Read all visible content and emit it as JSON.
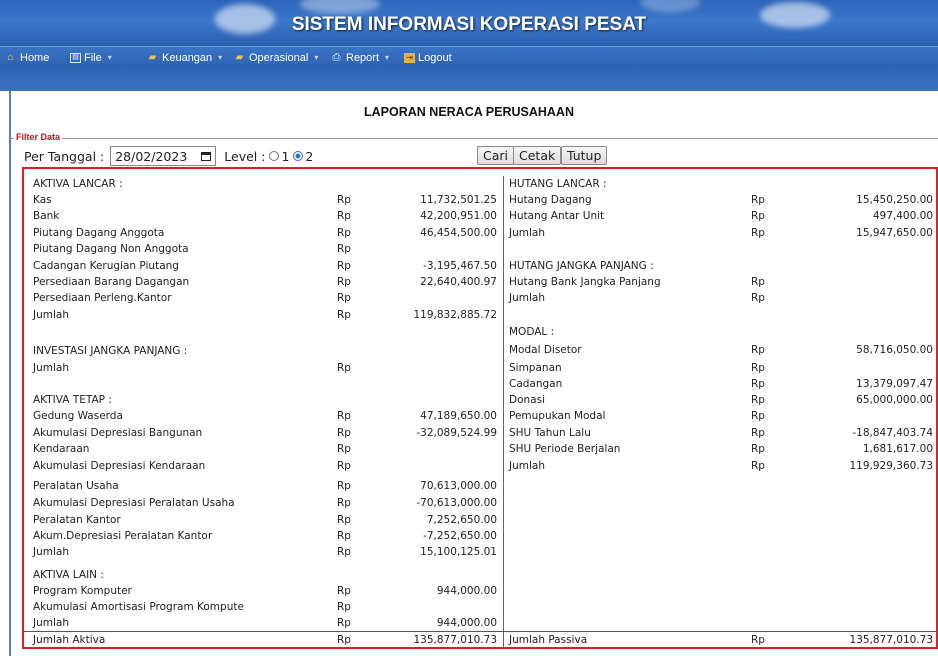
{
  "app": {
    "title": "SISTEM INFORMASI KOPERASI PESAT"
  },
  "menu": [
    {
      "label": "Home",
      "icon": "home-icon"
    },
    {
      "label": "File",
      "icon": "file-icon",
      "dropdown": true
    },
    {
      "label": "Keuangan",
      "icon": "folder-icon",
      "dropdown": true
    },
    {
      "label": "Operasional",
      "icon": "folder-icon",
      "dropdown": true
    },
    {
      "label": "Report",
      "icon": "printer-icon",
      "dropdown": true
    },
    {
      "label": "Logout",
      "icon": "logout-icon"
    }
  ],
  "page": {
    "title": "LAPORAN NERACA PERUSAHAAN"
  },
  "filter": {
    "legend": "Filter Data",
    "date_label": "Per Tanggal :",
    "date_value": "28/02/2023",
    "level_label": "Level :",
    "level_options": [
      "1",
      "2"
    ],
    "level_selected": "2",
    "buttons": {
      "cari": "Cari",
      "cetak": "Cetak",
      "tutup": "Tutup"
    }
  },
  "report": {
    "currency": "Rp",
    "left": [
      {
        "label": "AKTIVA LANCAR :",
        "type": "header"
      },
      {
        "label": "Kas",
        "value": "11,732,501.25"
      },
      {
        "label": "Bank",
        "value": "42,200,951.00"
      },
      {
        "label": "Piutang Dagang Anggota",
        "value": "46,454,500.00"
      },
      {
        "label": "Piutang Dagang Non Anggota",
        "value": ""
      },
      {
        "label": "Cadangan Kerugian Piutang",
        "value": "-3,195,467.50"
      },
      {
        "label": "Persediaan Barang Dagangan",
        "value": "22,640,400.97"
      },
      {
        "label": "Persediaan Perleng.Kantor",
        "value": ""
      },
      {
        "label": "Jumlah",
        "value": "119,832,885.72"
      },
      {
        "label": "INVESTASI JANGKA PANJANG :",
        "type": "header"
      },
      {
        "label": "Jumlah",
        "value": ""
      },
      {
        "label": "AKTIVA TETAP :",
        "type": "header"
      },
      {
        "label": "Gedung Waserda",
        "value": "47,189,650.00"
      },
      {
        "label": "Akumulasi Depresiasi Bangunan",
        "value": "-32,089,524.99"
      },
      {
        "label": "Kendaraan",
        "value": ""
      },
      {
        "label": "Akumulasi Depresiasi Kendaraan",
        "value": ""
      },
      {
        "label": "Peralatan Usaha",
        "value": "70,613,000.00"
      },
      {
        "label": "Akumulasi Depresiasi Peralatan Usaha",
        "value": "-70,613,000.00"
      },
      {
        "label": "Peralatan Kantor",
        "value": "7,252,650.00"
      },
      {
        "label": "Akum.Depresiasi Peralatan Kantor",
        "value": "-7,252,650.00"
      },
      {
        "label": "Jumlah",
        "value": "15,100,125.01"
      },
      {
        "label": "AKTIVA LAIN :",
        "type": "header"
      },
      {
        "label": "Program Komputer",
        "value": "944,000.00"
      },
      {
        "label": "Akumulasi Amortisasi Program Kompute",
        "value": ""
      },
      {
        "label": "Jumlah",
        "value": "944,000.00"
      }
    ],
    "right": [
      {
        "label": "HUTANG LANCAR :",
        "type": "header"
      },
      {
        "label": "Hutang Dagang",
        "value": "15,450,250.00"
      },
      {
        "label": "Hutang Antar Unit",
        "value": "497,400.00"
      },
      {
        "label": "Jumlah",
        "value": "15,947,650.00"
      },
      {
        "label": "HUTANG JANGKA PANJANG :",
        "type": "header"
      },
      {
        "label": "Hutang Bank Jangka Panjang",
        "value": ""
      },
      {
        "label": "Jumlah",
        "value": ""
      },
      {
        "label": "MODAL :",
        "type": "header"
      },
      {
        "label": "Modal Disetor",
        "value": "58,716,050.00"
      },
      {
        "label": "Simpanan",
        "value": ""
      },
      {
        "label": "Cadangan",
        "value": "13,379,097.47"
      },
      {
        "label": "Donasi",
        "value": "65,000,000.00"
      },
      {
        "label": "Pemupukan Modal",
        "value": ""
      },
      {
        "label": "SHU Tahun Lalu",
        "value": "-18,847,403.74"
      },
      {
        "label": "SHU Periode Berjalan",
        "value": "1,681,617.00"
      },
      {
        "label": "Jumlah",
        "value": "119,929,360.73"
      }
    ],
    "totals": {
      "aktiva_label": "Jumlah Aktiva",
      "aktiva_value": "135,877,010.73",
      "passiva_label": "Jumlah Passiva",
      "passiva_value": "135,877,010.73"
    }
  },
  "colors": {
    "header_blue": "#2b63b8",
    "highlight_red": "#e02020",
    "filter_red": "#c4161c"
  }
}
